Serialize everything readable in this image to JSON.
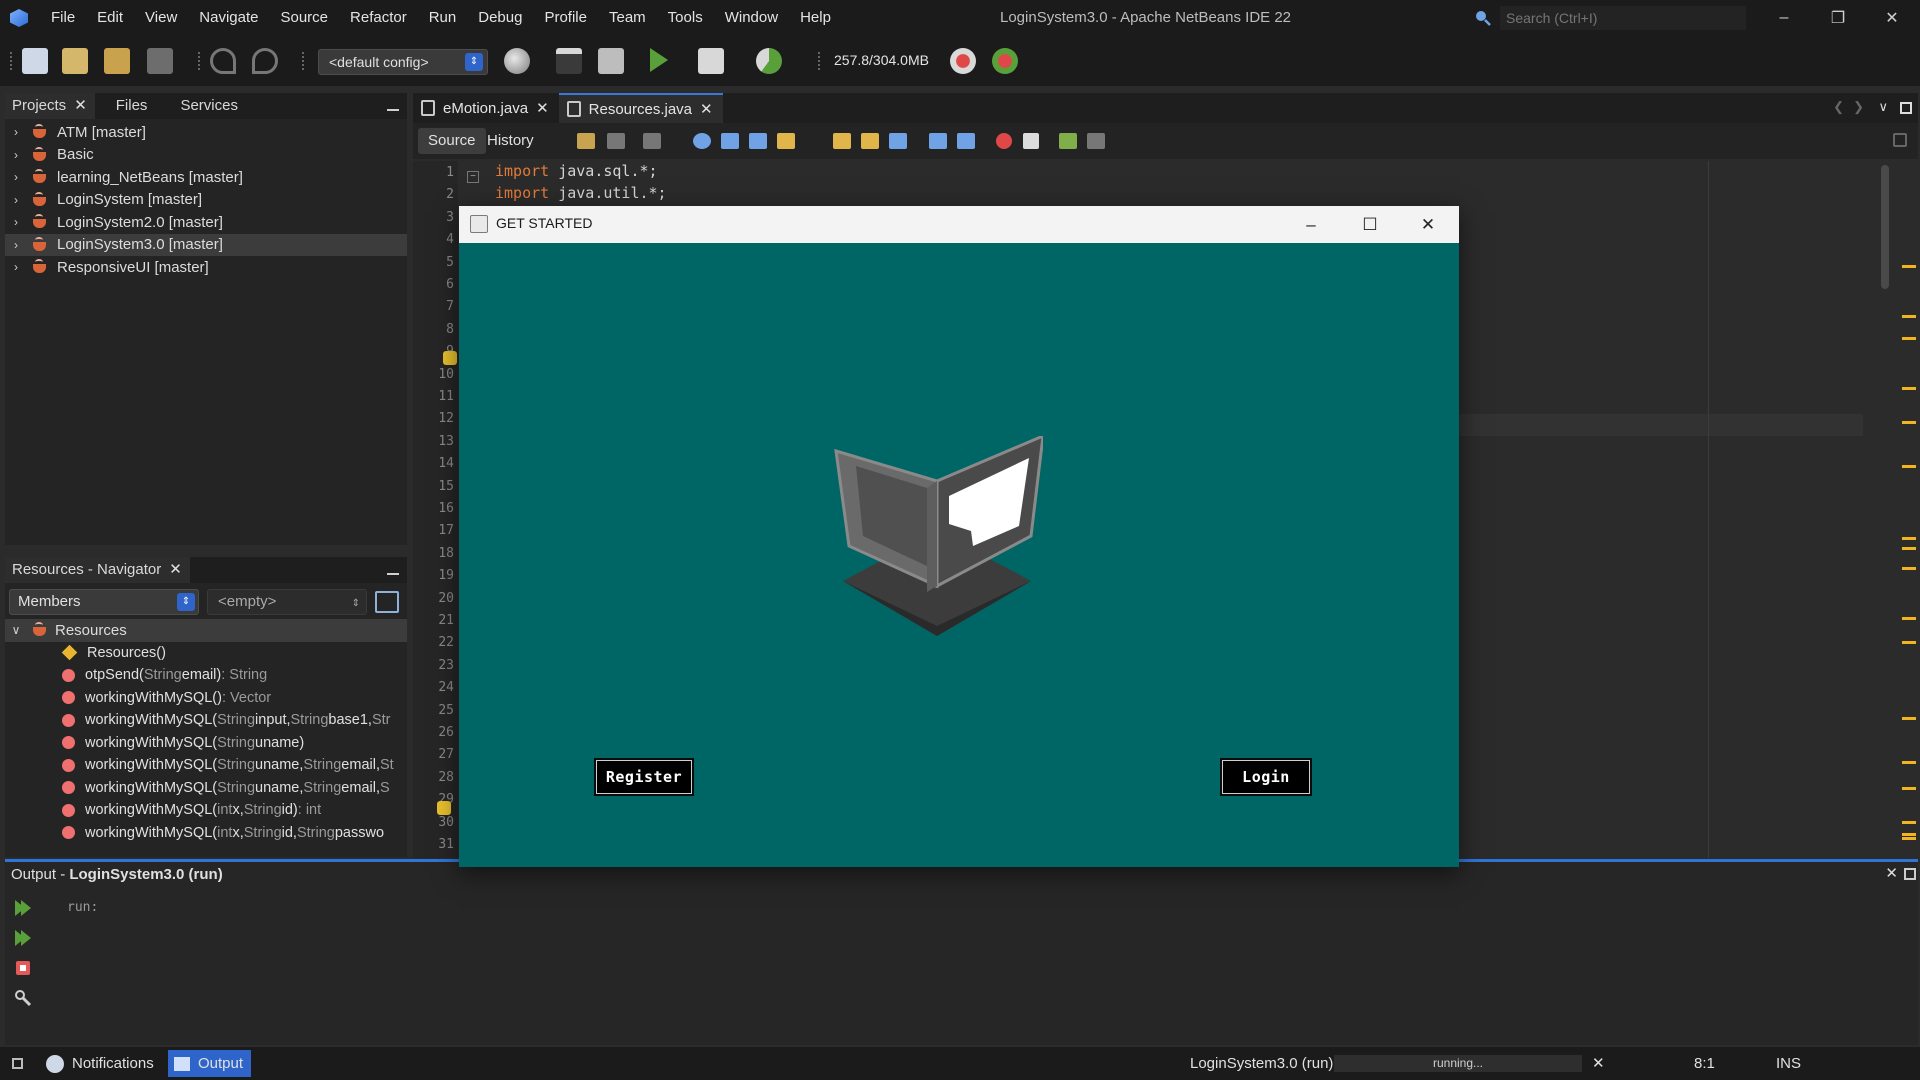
{
  "app": {
    "window_title": "LoginSystem3.0 - Apache NetBeans IDE 22",
    "menu": [
      "File",
      "Edit",
      "View",
      "Navigate",
      "Source",
      "Refactor",
      "Run",
      "Debug",
      "Profile",
      "Team",
      "Tools",
      "Window",
      "Help"
    ],
    "search_placeholder": "Search (Ctrl+I)"
  },
  "toolbar": {
    "config": "<default config>",
    "memory": "257.8/304.0MB"
  },
  "projects_panel": {
    "tabs": [
      "Projects",
      "Files",
      "Services"
    ],
    "projects": [
      {
        "label": "ATM [master]"
      },
      {
        "label": "Basic"
      },
      {
        "label": "learning_NetBeans [master]"
      },
      {
        "label": "LoginSystem [master]"
      },
      {
        "label": "LoginSystem2.0 [master]"
      },
      {
        "label": "LoginSystem3.0 [master]",
        "selected": true
      },
      {
        "label": "ResponsiveUI [master]"
      }
    ]
  },
  "navigator": {
    "title": "Resources - Navigator",
    "members_select": "Members",
    "scope_select": "<empty>",
    "root": "Resources",
    "members": [
      {
        "icon": "constructor",
        "name": "Resources()",
        "params": "",
        "ret": ""
      },
      {
        "icon": "method",
        "name": "otpSend(",
        "params": [
          [
            "String",
            " email)"
          ]
        ],
        "ret": " : String"
      },
      {
        "icon": "method",
        "name": "workingWithMySQL()",
        "params": [],
        "ret": " : Vector"
      },
      {
        "icon": "method",
        "name": "workingWithMySQL(",
        "params": [
          [
            "String",
            " input, "
          ],
          [
            "String",
            " base1, "
          ],
          [
            "Str",
            ""
          ]
        ],
        "ret": ""
      },
      {
        "icon": "method",
        "name": "workingWithMySQL(",
        "params": [
          [
            "String",
            " uname)"
          ]
        ],
        "ret": ""
      },
      {
        "icon": "method",
        "name": "workingWithMySQL(",
        "params": [
          [
            "String",
            " uname, "
          ],
          [
            "String",
            " email, "
          ],
          [
            "St",
            ""
          ]
        ],
        "ret": ""
      },
      {
        "icon": "method",
        "name": "workingWithMySQL(",
        "params": [
          [
            "String",
            " uname, "
          ],
          [
            "String",
            " email, "
          ],
          [
            "S",
            ""
          ]
        ],
        "ret": ""
      },
      {
        "icon": "method",
        "name": "workingWithMySQL(",
        "params": [
          [
            "int",
            " x, "
          ],
          [
            "String",
            " id)"
          ]
        ],
        "ret": " : int"
      },
      {
        "icon": "method",
        "name": "workingWithMySQL(",
        "params": [
          [
            "int",
            " x, "
          ],
          [
            "String",
            " id, "
          ],
          [
            "String",
            " passwo"
          ]
        ],
        "ret": ""
      }
    ]
  },
  "editor": {
    "tabs": [
      {
        "label": "eMotion.java"
      },
      {
        "label": "Resources.java",
        "active": true
      }
    ],
    "source_label": "Source",
    "history_label": "History",
    "line_numbers": [
      "1",
      "2",
      "3",
      "4",
      "5",
      "6",
      "7",
      "8",
      "9",
      "10",
      "11",
      "12",
      "13",
      "14",
      "15",
      "16",
      "17",
      "18",
      "19",
      "20",
      "21",
      "22",
      "23",
      "24",
      "25",
      "26",
      "27",
      "28",
      "29",
      "30",
      "31"
    ],
    "code": [
      {
        "kw": "import",
        "rest": " java.sql.*;"
      },
      {
        "kw": "import",
        "rest": " java.util.*;"
      }
    ]
  },
  "dialog": {
    "title": "GET STARTED",
    "register_label": "Register",
    "login_label": "Login",
    "background": "#006565"
  },
  "output": {
    "title_prefix": "Output - ",
    "title_bold": "LoginSystem3.0 (run)",
    "text": "run:"
  },
  "statusbar": {
    "notifications": "Notifications",
    "output": "Output",
    "run_label": "LoginSystem3.0 (run)",
    "progress": "running...",
    "position": "8:1",
    "mode": "INS"
  },
  "colors": {
    "accent": "#2f65ca",
    "keyword": "#e07a3a",
    "method_icon": "#f07070",
    "constructor_icon": "#e9b531",
    "warning_mark": "#f0b521"
  }
}
